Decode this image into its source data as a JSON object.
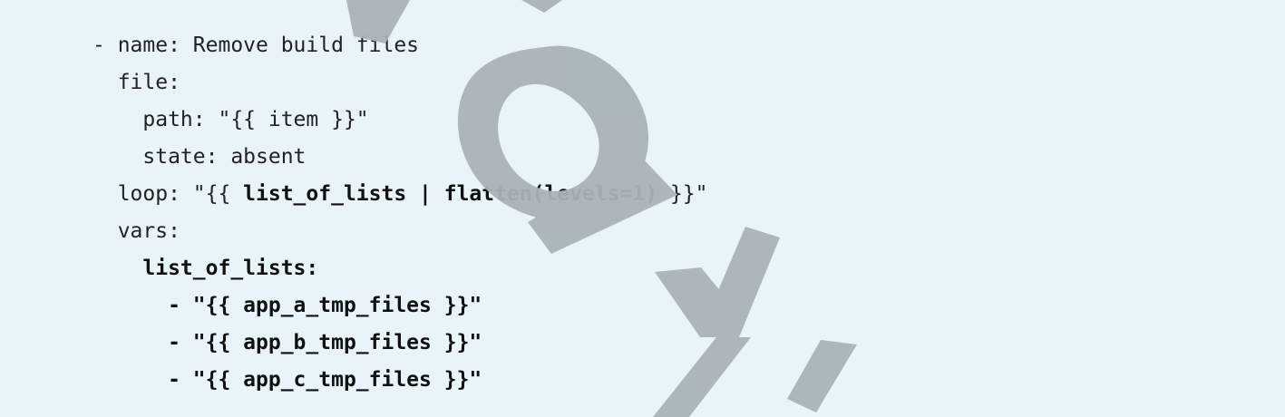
{
  "code": {
    "language": "yaml",
    "lines": [
      [
        {
          "t": "- name: Remove build files",
          "b": false
        }
      ],
      [
        {
          "t": "  file:",
          "b": false
        }
      ],
      [
        {
          "t": "    path: \"{{ item }}\"",
          "b": false
        }
      ],
      [
        {
          "t": "    state: absent",
          "b": false
        }
      ],
      [
        {
          "t": "  loop: \"{{ ",
          "b": false
        },
        {
          "t": "list_of_lists | flatten(levels=1)",
          "b": true
        },
        {
          "t": " }}\"",
          "b": false
        }
      ],
      [
        {
          "t": "  vars:",
          "b": false
        }
      ],
      [
        {
          "t": "    ",
          "b": false
        },
        {
          "t": "list_of_lists:",
          "b": true
        }
      ],
      [
        {
          "t": "      - \"{{ app_a_tmp_files }}\"",
          "b": true
        }
      ],
      [
        {
          "t": "      - \"{{ app_b_tmp_files }}\"",
          "b": true
        }
      ],
      [
        {
          "t": "      - \"{{ app_c_tmp_files }}\"",
          "b": true
        }
      ]
    ]
  },
  "colors": {
    "background": "#e8f4fa",
    "text": "#222222",
    "watermark": "#a9b3b8"
  }
}
